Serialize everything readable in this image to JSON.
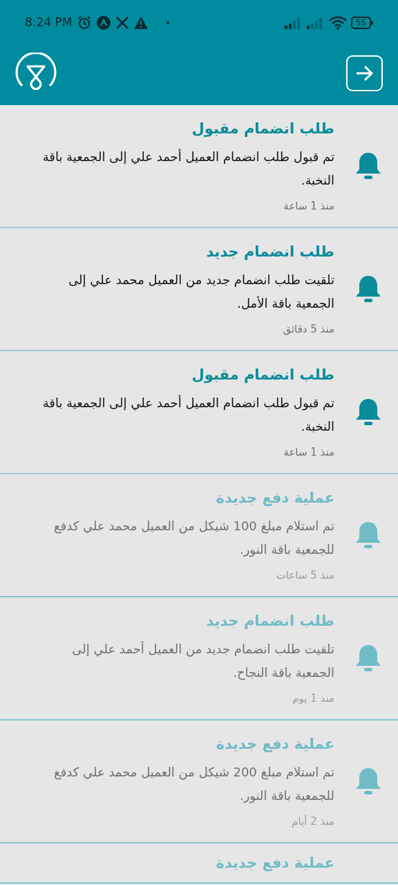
{
  "status_bar": {
    "time": "8:24 PM",
    "battery": "55"
  },
  "notifications": [
    {
      "title": "طلب انضمام مقبول",
      "body": "تم قبول طلب انضمام العميل أحمد علي إلى الجمعية باقة النخبة.",
      "time": "منذ 1 ساعة",
      "read": false
    },
    {
      "title": "طلب انضمام جديد",
      "body": "تلقيت طلب انضمام جديد من العميل محمد علي إلى الجمعية باقة الأمل.",
      "time": "منذ 5 دقائق",
      "read": false
    },
    {
      "title": "طلب انضمام مقبول",
      "body": "تم قبول طلب انضمام العميل أحمد علي إلى الجمعية باقة النخبة.",
      "time": "منذ 1 ساعة",
      "read": false
    },
    {
      "title": "عملية دفع جديدة",
      "body": "تم استلام مبلغ 100 شيكل من العميل محمد علي كدفع للجمعية باقة النور.",
      "time": "منذ 5 ساعات",
      "read": true
    },
    {
      "title": "طلب انضمام جديد",
      "body": "تلقيت طلب انضمام جديد من العميل أحمد علي إلى الجمعية باقة النجاح.",
      "time": "منذ 1 يوم",
      "read": true
    },
    {
      "title": "عملية دفع جديدة",
      "body": "تم استلام مبلغ 200 شيكل من العميل محمد علي كدفع للجمعية باقة النور.",
      "time": "منذ 2 أيام",
      "read": true
    },
    {
      "title": "عملية دفع جديدة",
      "read": true
    }
  ]
}
